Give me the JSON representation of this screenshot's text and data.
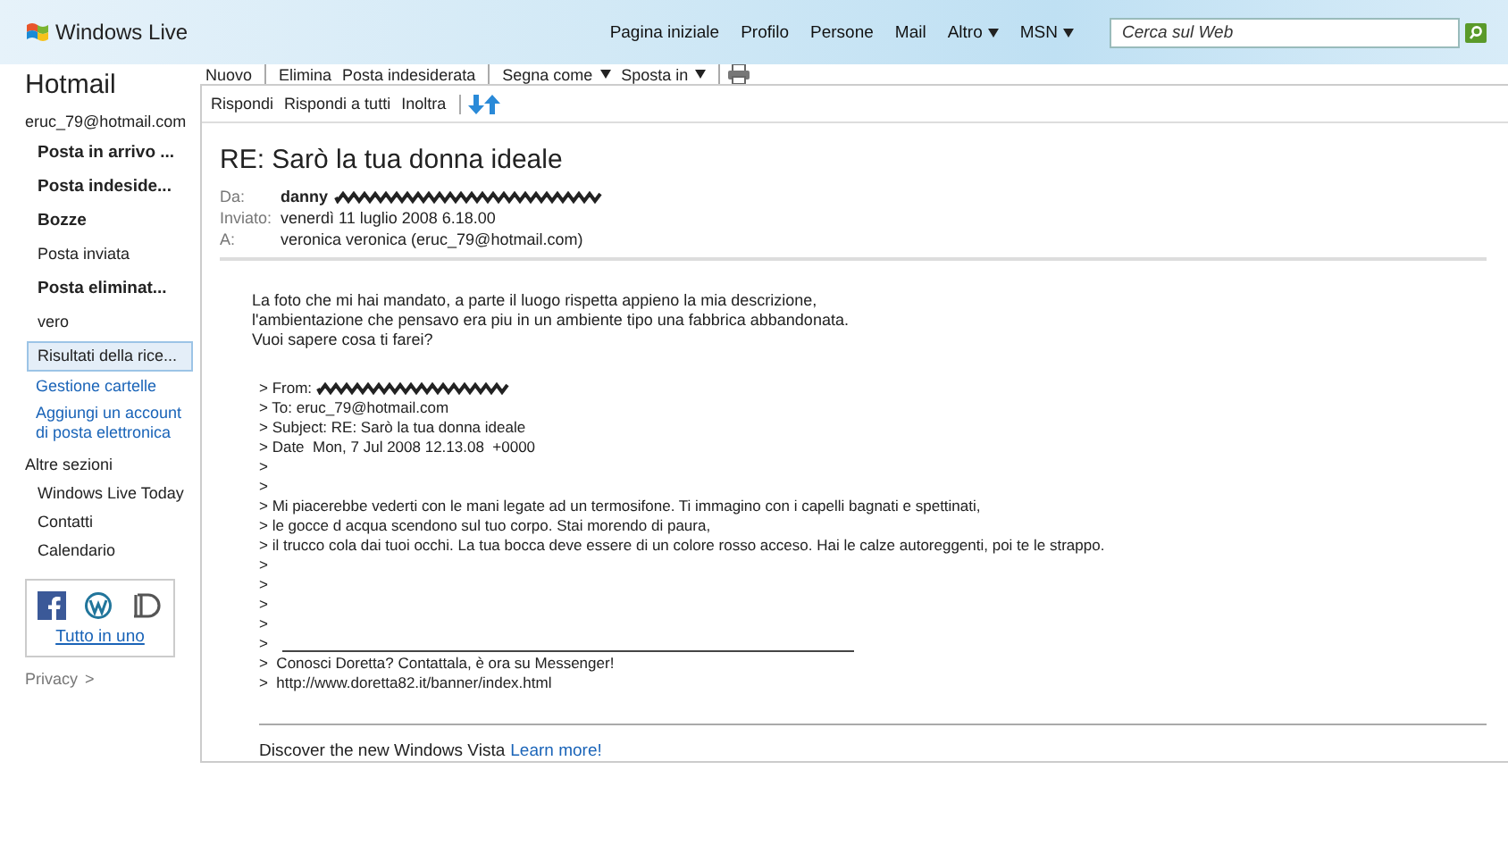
{
  "header": {
    "brand": "Windows Live",
    "nav": [
      {
        "label": "Pagina iniziale",
        "menu": false
      },
      {
        "label": "Profilo",
        "menu": false
      },
      {
        "label": "Persone",
        "menu": false
      },
      {
        "label": "Mail",
        "menu": false
      },
      {
        "label": "Altro",
        "menu": true
      },
      {
        "label": "MSN",
        "menu": true
      }
    ],
    "search": {
      "placeholder": "Cerca sul Web"
    }
  },
  "sidebar": {
    "title": "Hotmail",
    "account": "eruc_79@hotmail.com",
    "folders": [
      {
        "label": "Posta in arrivo ...",
        "unread": true,
        "selected": false
      },
      {
        "label": "Posta indeside...",
        "unread": true,
        "selected": false
      },
      {
        "label": "Bozze",
        "unread": true,
        "selected": false
      },
      {
        "label": "Posta inviata",
        "unread": false,
        "selected": false
      },
      {
        "label": "Posta eliminat...",
        "unread": true,
        "selected": false
      },
      {
        "label": "vero",
        "unread": false,
        "selected": false
      },
      {
        "label": "Risultati della rice...",
        "unread": false,
        "selected": true
      }
    ],
    "links": [
      "Gestione cartelle",
      "Aggiungi un account di posta elettronica"
    ],
    "sections_title": "Altre sezioni",
    "sections": [
      "Windows Live Today",
      "Contatti",
      "Calendario"
    ],
    "social_link": "Tutto in uno",
    "privacy": "Privacy",
    "privacy_arrow": ">"
  },
  "toolbar": {
    "groups": [
      [
        {
          "label": "Nuovo",
          "menu": false
        }
      ],
      [
        {
          "label": "Elimina",
          "menu": false
        },
        {
          "label": "Posta indesiderata",
          "menu": false
        }
      ],
      [
        {
          "label": "Segna come",
          "menu": true
        },
        {
          "label": "Sposta in",
          "menu": true
        }
      ]
    ],
    "actions": [
      {
        "label": "Rispondi"
      },
      {
        "label": "Rispondi a tutti"
      },
      {
        "label": "Inoltra"
      }
    ]
  },
  "message": {
    "subject": "RE: Sarò la tua donna ideale",
    "fields": [
      {
        "label": "Da:",
        "value": "danny",
        "bold": true,
        "redacted": true
      },
      {
        "label": "Inviato:",
        "value": "venerdì 11 luglio 2008  6.18.00",
        "bold": false,
        "redacted": false
      },
      {
        "label": "A:",
        "value": "veronica veronica (eruc_79@hotmail.com)",
        "bold": false,
        "redacted": false
      }
    ],
    "body": [
      "La foto che mi hai mandato, a parte il luogo rispetta appieno la mia descrizione,",
      "l'ambientazione che pensavo era piu in un ambiente tipo una fabbrica abbandonata.",
      "Vuoi sapere cosa ti farei?"
    ],
    "quote": [
      {
        "kind": "text",
        "text": "> From:",
        "redacted": true
      },
      {
        "kind": "text",
        "text": "> To: eruc_79@hotmail.com",
        "redacted": false
      },
      {
        "kind": "text",
        "text": "> Subject: RE: Sarò la tua donna ideale",
        "redacted": false
      },
      {
        "kind": "text",
        "text": "> Date  Mon, 7 Jul 2008 12.13.08  +0000",
        "redacted": false
      },
      {
        "kind": "text",
        "text": ">",
        "redacted": false
      },
      {
        "kind": "text",
        "text": ">",
        "redacted": false
      },
      {
        "kind": "text",
        "text": "> Mi piacerebbe vederti con le mani legate ad un termosifone. Ti immagino con i capelli bagnati e spettinati,",
        "redacted": false
      },
      {
        "kind": "text",
        "text": "> le gocce d acqua scendono sul tuo corpo. Stai morendo di paura,",
        "redacted": false
      },
      {
        "kind": "text",
        "text": "> il trucco cola dai tuoi occhi. La tua bocca deve essere di un colore rosso acceso. Hai le calze autoreggenti, poi te le strappo.",
        "redacted": false
      },
      {
        "kind": "text",
        "text": ">",
        "redacted": false
      },
      {
        "kind": "text",
        "text": ">",
        "redacted": false
      },
      {
        "kind": "text",
        "text": ">",
        "redacted": false
      },
      {
        "kind": "text",
        "text": ">",
        "redacted": false
      },
      {
        "kind": "rule",
        "text": ">",
        "redacted": false
      },
      {
        "kind": "text",
        "text": ">  Conosci Doretta? Contattala, è ora su Messenger!",
        "redacted": false
      },
      {
        "kind": "text",
        "text": ">  http://www.doretta82.it/banner/index.html",
        "redacted": false
      }
    ],
    "footer": {
      "text": "Discover the new Windows Vista",
      "link": "Learn more!"
    }
  }
}
